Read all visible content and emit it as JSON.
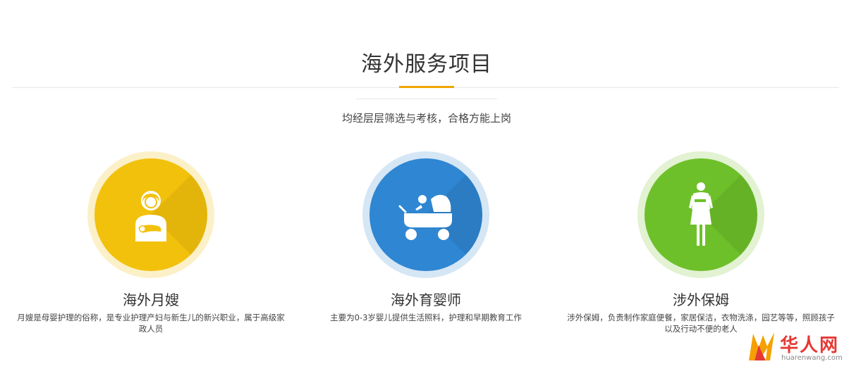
{
  "section": {
    "title": "海外服务项目",
    "subtitle": "均经层层筛选与考核，合格方能上岗"
  },
  "colors": {
    "accent": "#f0a500",
    "yellow": "#f2c10c",
    "blue": "#2f86d2",
    "green": "#6ec02a",
    "logo_red": "#e53935",
    "logo_orange": "#f5a000"
  },
  "services": [
    {
      "title": "海外月嫂",
      "description": "月嫂是母婴护理的俗称，是专业护理产妇与新生儿的新兴职业，属于高级家政人员",
      "icon": "mother-baby-icon"
    },
    {
      "title": "海外育婴师",
      "description": "主要为0-3岁婴儿提供生活照料，护理和早期教育工作",
      "icon": "baby-stroller-icon"
    },
    {
      "title": "涉外保姆",
      "description": "涉外保姆，负责制作家庭便餐，家居保洁，衣物洗涤，园艺等等，照顾孩子以及行动不便的老人",
      "icon": "housekeeper-icon"
    }
  ],
  "logo": {
    "name": "华人网",
    "url_text": "huarenwang.com"
  }
}
